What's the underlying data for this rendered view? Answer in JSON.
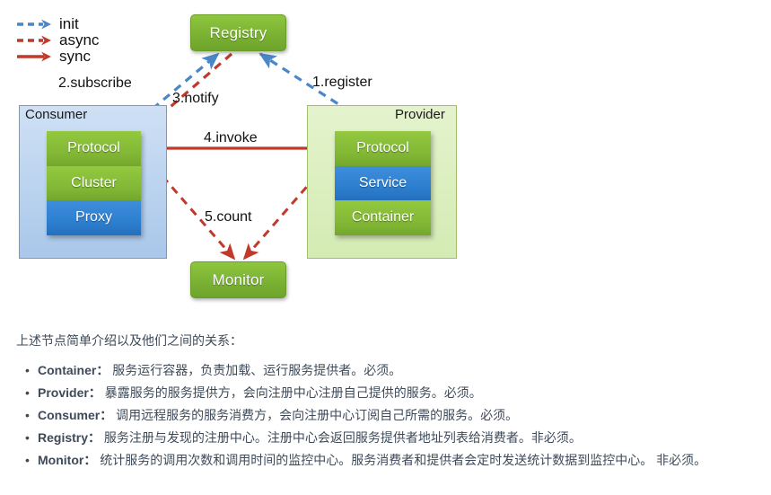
{
  "diagram": {
    "legend": [
      {
        "label": "init",
        "style": "dashed",
        "color": "#4a86c8"
      },
      {
        "label": "async",
        "style": "dashed",
        "color": "#c0392b"
      },
      {
        "label": "sync",
        "style": "solid",
        "color": "#c0392b"
      }
    ],
    "nodes": {
      "registry": "Registry",
      "monitor": "Monitor",
      "consumer": "Consumer",
      "provider": "Provider"
    },
    "consumer_layers": [
      {
        "label": "Protocol",
        "color": "green"
      },
      {
        "label": "Cluster",
        "color": "green"
      },
      {
        "label": "Proxy",
        "color": "blue"
      }
    ],
    "provider_layers": [
      {
        "label": "Protocol",
        "color": "green"
      },
      {
        "label": "Service",
        "color": "blue"
      },
      {
        "label": "Container",
        "color": "green"
      }
    ],
    "flows": {
      "register": "1.register",
      "subscribe": "2.subscribe",
      "notify": "3.notify",
      "invoke": "4.invoke",
      "count": "5.count"
    },
    "colors": {
      "init": "#4a86c8",
      "async": "#c0392b",
      "sync": "#c0392b",
      "green_node": "#7bb233",
      "blue_layer": "#2d7fd0",
      "consumer_bg": "#bcd4ef",
      "provider_bg": "#dcefc0"
    }
  },
  "prose": {
    "intro": "上述节点简单介绍以及他们之间的关系：",
    "bullets": [
      {
        "term": "Container：",
        "desc": " 服务运行容器，负责加载、运行服务提供者。必须。"
      },
      {
        "term": "Provider：",
        "desc": " 暴露服务的服务提供方，会向注册中心注册自己提供的服务。必须。"
      },
      {
        "term": "Consumer：",
        "desc": " 调用远程服务的服务消费方，会向注册中心订阅自己所需的服务。必须。"
      },
      {
        "term": "Registry：",
        "desc": " 服务注册与发现的注册中心。注册中心会返回服务提供者地址列表给消费者。非必须。"
      },
      {
        "term": "Monitor：",
        "desc": " 统计服务的调用次数和调用时间的监控中心。服务消费者和提供者会定时发送统计数据到监控中心。 非必须。"
      }
    ]
  }
}
